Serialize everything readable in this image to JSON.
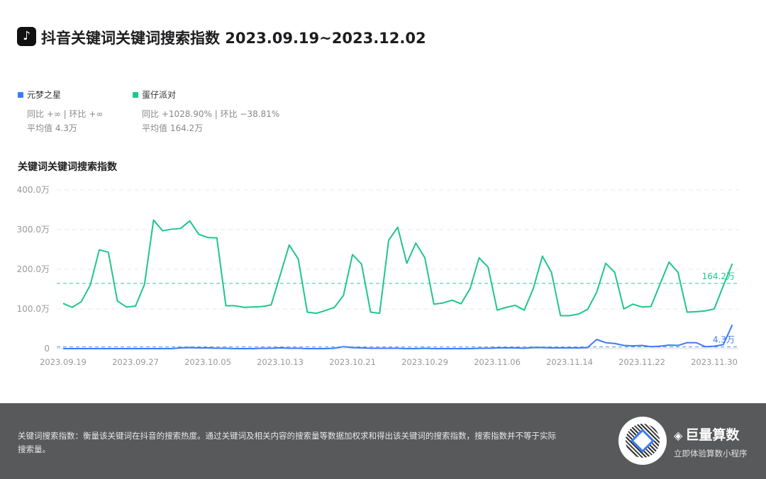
{
  "header": {
    "title": "抖音关键词关键词搜索指数 2023.09.19~2023.12.02",
    "logo": "douyin-logo"
  },
  "legend": [
    {
      "name": "元梦之星",
      "color": "#3b7cf5",
      "compare": "同比 +∞ | 环比 +∞",
      "avg": "平均值 4.3万"
    },
    {
      "name": "蛋仔派对",
      "color": "#1fc590",
      "compare": "同比 +1028.90% | 环比 −38.81%",
      "avg": "平均值 164.2万"
    }
  ],
  "chart_data": {
    "type": "line",
    "title": "关键词关键词搜索指数",
    "xlabel": "",
    "ylabel": "",
    "ylim": [
      0,
      400
    ],
    "unit": "万",
    "yticks": [
      "0",
      "100.0万",
      "200.0万",
      "300.0万",
      "400.0万"
    ],
    "xticks": [
      "2023.09.19",
      "2023.09.27",
      "2023.10.05",
      "2023.10.13",
      "2023.10.21",
      "2023.10.29",
      "2023.11.06",
      "2023.11.14",
      "2023.11.22",
      "2023.11.30"
    ],
    "x_start": "2023.09.19",
    "x_end": "2023.12.02",
    "days": 75,
    "grid": true,
    "series": [
      {
        "name": "蛋仔派对",
        "color": "#1fc590",
        "average": 164.2,
        "average_label": "164.2万",
        "values": [
          114,
          104,
          118,
          160,
          249,
          243,
          120,
          105,
          107,
          162,
          324,
          297,
          301,
          303,
          322,
          288,
          280,
          279,
          108,
          108,
          104,
          105,
          106,
          110,
          185,
          261,
          226,
          92,
          89,
          96,
          104,
          134,
          237,
          213,
          92,
          89,
          273,
          306,
          215,
          266,
          229,
          112,
          115,
          122,
          113,
          151,
          229,
          205,
          97,
          104,
          109,
          97,
          152,
          233,
          192,
          83,
          83,
          87,
          99,
          142,
          215,
          192,
          100,
          112,
          105,
          106,
          162,
          218,
          192,
          92,
          93,
          95,
          100,
          158,
          214
        ]
      },
      {
        "name": "元梦之星",
        "color": "#3b7cf5",
        "average": 4.3,
        "average_label": "4.3万",
        "values": [
          0,
          0,
          0,
          0,
          0,
          0,
          0,
          0,
          0,
          0,
          0,
          0,
          0,
          2,
          3,
          2,
          2,
          1,
          1,
          0,
          0,
          0,
          1,
          1,
          2,
          1,
          1,
          0,
          0,
          0,
          1,
          5,
          3,
          2,
          1,
          1,
          1,
          1,
          0,
          0,
          1,
          0,
          0,
          0,
          0,
          0,
          1,
          1,
          2,
          2,
          2,
          1,
          3,
          3,
          2,
          2,
          2,
          2,
          3,
          23,
          15,
          13,
          8,
          7,
          8,
          5,
          6,
          9,
          8,
          15,
          15,
          5,
          6,
          10,
          60
        ]
      }
    ]
  },
  "footer": {
    "note": "关键词搜索指数：衡量该关键词在抖音的搜索热度。通过关键词及相关内容的搜索量等数据加权求和得出该关键词的搜索指数，搜索指数并不等于实际搜索量。",
    "brand": "巨量算数",
    "brand_sub": "立即体验算数小程序"
  }
}
